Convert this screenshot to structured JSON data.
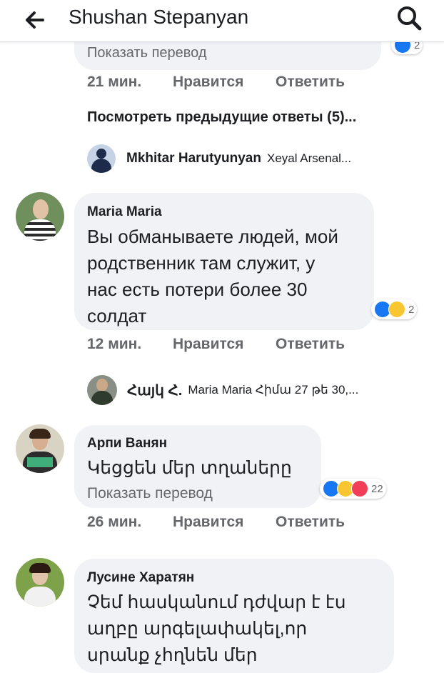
{
  "header": {
    "title": "Shushan Stepanyan"
  },
  "thread_top": {
    "translate": "Показать перевод",
    "reaction_count": "2",
    "time": "21 мин.",
    "like": "Нравится",
    "reply": "Ответить",
    "view_previous": "Посмотреть предыдущие ответы (5)..."
  },
  "reply_preview_1": {
    "author": "Mkhitar Harutyunyan",
    "text": "Xeyal Arsenal..."
  },
  "comment_1": {
    "author": "Maria Maria",
    "lines": [
      "Вы обманываете людей, мой",
      "родственник там служит, у",
      "нас есть потери более 30",
      "солдат"
    ],
    "reaction_count": "2",
    "time": "12 мин.",
    "like": "Нравится",
    "reply": "Ответить"
  },
  "reply_preview_2": {
    "author": "Հայկ Հ.",
    "text": "Maria Maria Հիմա 27 թե 30,..."
  },
  "comment_2": {
    "author": "Арпи Ванян",
    "text": "Կեցցեն մեր տղաները",
    "translate": "Показать перевод",
    "reaction_count": "22",
    "time": "26 мин.",
    "like": "Нравится",
    "reply": "Ответить"
  },
  "comment_3": {
    "author": "Лусине Харатян",
    "lines": [
      "Չեմ հասկանում դժվար է էս",
      "աղբը արգելափակել,որ",
      "սրանք չհղնեն մեր"
    ]
  }
}
